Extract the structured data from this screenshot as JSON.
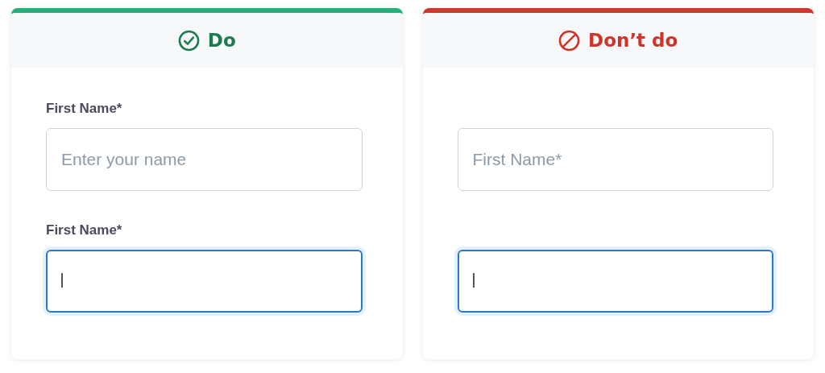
{
  "cards": [
    {
      "kind": "do",
      "title": "Do",
      "fields": [
        {
          "label": "First Name*",
          "placeholder": "Enter your name",
          "focused": false
        },
        {
          "label": "First Name*",
          "focused": true
        }
      ]
    },
    {
      "kind": "dont",
      "title": "Don’t do",
      "fields": [
        {
          "placeholder": "First Name*",
          "focused": false
        },
        {
          "focused": true
        }
      ]
    }
  ]
}
